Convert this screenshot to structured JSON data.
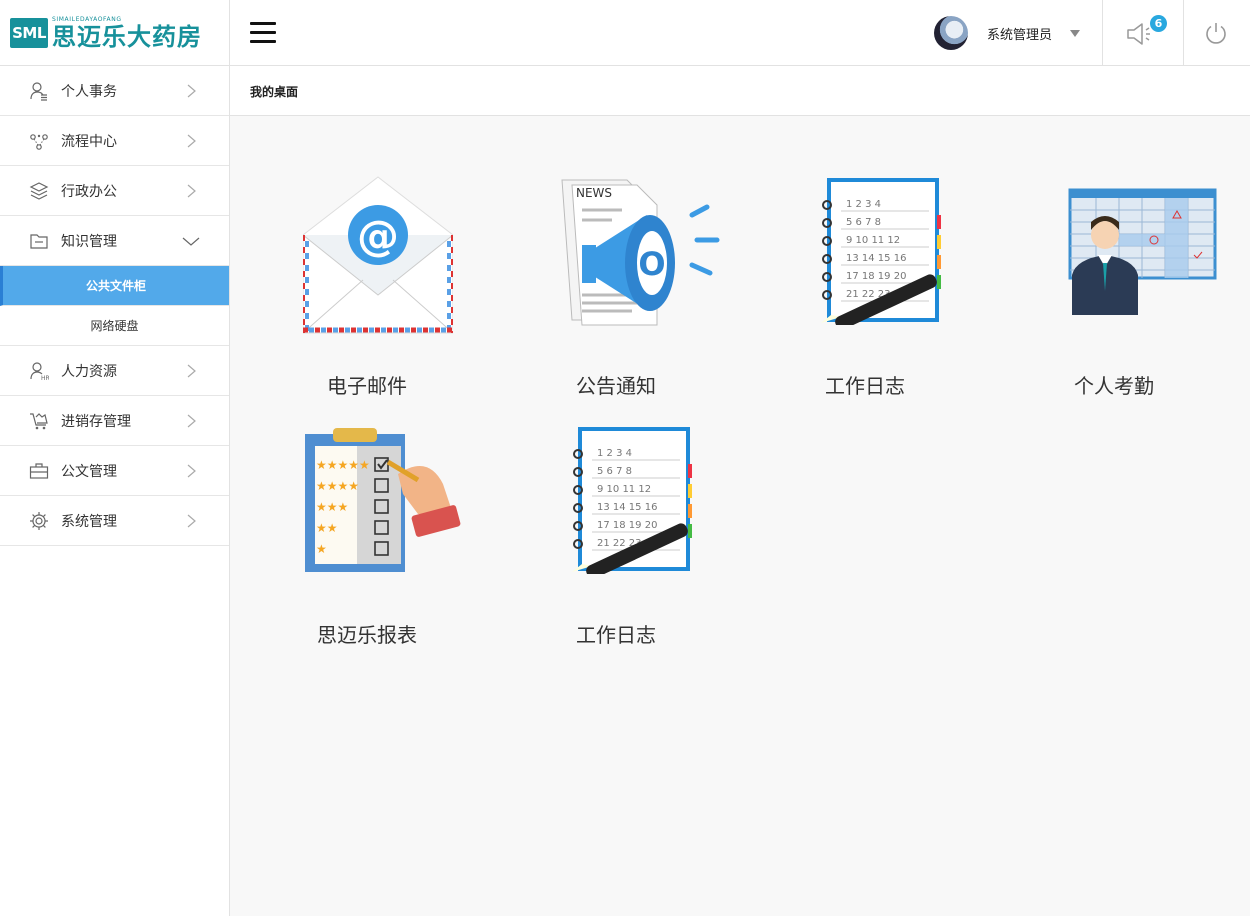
{
  "logo": {
    "badge": "SML",
    "sub": "SIMAILEDAYAOFANG",
    "text": "思迈乐大药房"
  },
  "header": {
    "user_name": "系统管理员",
    "notification_count": "6"
  },
  "sidebar": {
    "items": [
      {
        "label": "个人事务",
        "icon": "person-list-icon"
      },
      {
        "label": "流程中心",
        "icon": "workflow-icon"
      },
      {
        "label": "行政办公",
        "icon": "layers-icon"
      },
      {
        "label": "知识管理",
        "icon": "folder-icon",
        "expanded": true,
        "children": [
          {
            "label": "公共文件柜",
            "active": true
          },
          {
            "label": "网络硬盘",
            "active": false
          }
        ]
      },
      {
        "label": "人力资源",
        "icon": "hr-person-icon"
      },
      {
        "label": "进销存管理",
        "icon": "cart-icon"
      },
      {
        "label": "公文管理",
        "icon": "briefcase-icon"
      },
      {
        "label": "系统管理",
        "icon": "gear-icon"
      }
    ]
  },
  "breadcrumb": {
    "label": "我的桌面"
  },
  "desktop": {
    "tiles": [
      {
        "label": "电子邮件",
        "icon": "email-envelope-icon"
      },
      {
        "label": "公告通知",
        "icon": "news-megaphone-icon"
      },
      {
        "label": "工作日志",
        "icon": "calendar-notebook-icon"
      },
      {
        "label": "个人考勤",
        "icon": "attendance-chart-icon"
      },
      {
        "label": "思迈乐报表",
        "icon": "clipboard-rating-icon"
      },
      {
        "label": "工作日志",
        "icon": "calendar-notebook-icon"
      }
    ]
  },
  "colors": {
    "brand": "#17919b",
    "active": "#52a9ea",
    "badge": "#29a8df"
  }
}
